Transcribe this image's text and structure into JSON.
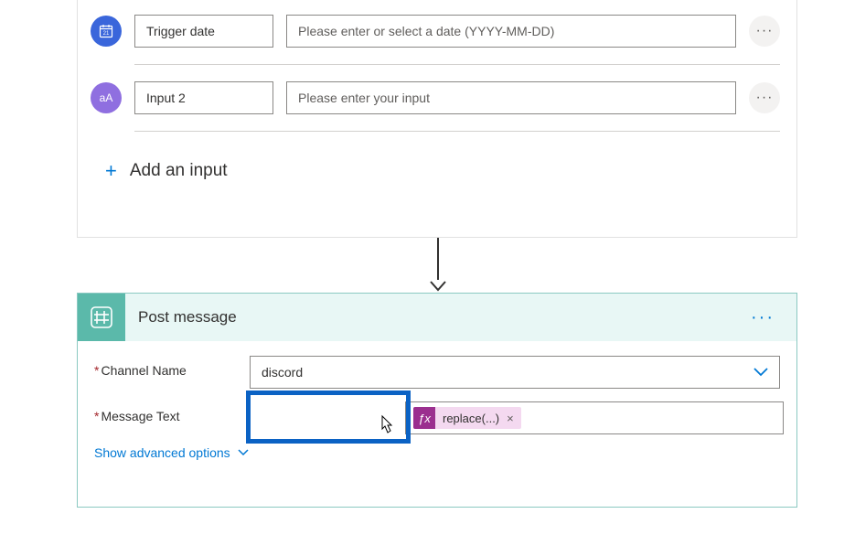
{
  "trigger": {
    "rows": [
      {
        "icon": "calendar",
        "name": "Trigger date",
        "placeholder": "Please enter or select a date (YYYY-MM-DD)"
      },
      {
        "icon": "text",
        "name": "Input 2",
        "placeholder": "Please enter your input"
      }
    ],
    "add_label": "Add an input"
  },
  "action": {
    "title": "Post message",
    "fields": {
      "channel_label": "Channel Name",
      "channel_value": "discord",
      "message_label": "Message Text",
      "fx_pill": "replace(...)"
    },
    "advanced_label": "Show advanced options"
  },
  "icons": {
    "text_aa": "aA"
  }
}
